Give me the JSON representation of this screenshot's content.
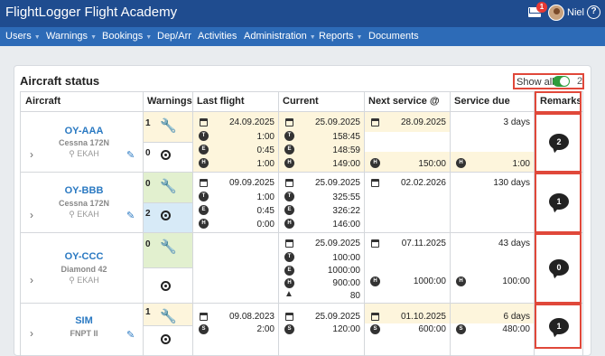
{
  "header": {
    "brand": "FlightLogger Flight Academy",
    "mail_badge": "1",
    "username": "Niel",
    "help_glyph": "?"
  },
  "nav": [
    {
      "label": "Users",
      "dropdown": true
    },
    {
      "label": "Warnings",
      "dropdown": true
    },
    {
      "label": "Bookings",
      "dropdown": true
    },
    {
      "label": "Dep/Arr",
      "dropdown": false
    },
    {
      "label": "Activities",
      "dropdown": false
    },
    {
      "label": "Administration",
      "dropdown": true
    },
    {
      "label": "Reports",
      "dropdown": true
    },
    {
      "label": "Documents",
      "dropdown": false
    }
  ],
  "panel": {
    "title": "Aircraft status",
    "show_all_label": "Show all",
    "show_all_on": true,
    "show_all_count": "2"
  },
  "columns": [
    "Aircraft",
    "Warnings",
    "Last flight",
    "Current",
    "Next service @",
    "Service due",
    "Remarks"
  ],
  "rows": [
    {
      "registration": "OY-AAA",
      "model": "Cessna 172N",
      "location": "EKAH",
      "warnings": {
        "maintenance": "1",
        "tyre": "0"
      },
      "last_flight": [
        "24.09.2025",
        "1:00",
        "0:45",
        "1:00"
      ],
      "current": [
        "25.09.2025",
        "158:45",
        "148:59",
        "149:00"
      ],
      "next_service": [
        "28.09.2025",
        "150:00"
      ],
      "service_due": [
        "3 days",
        "1:00"
      ],
      "remarks": "2"
    },
    {
      "registration": "OY-BBB",
      "model": "Cessna 172N",
      "location": "EKAH",
      "warnings": {
        "maintenance": "0",
        "tyre": "2"
      },
      "last_flight": [
        "09.09.2025",
        "1:00",
        "0:45",
        "0:00"
      ],
      "current": [
        "25.09.2025",
        "325:55",
        "326:22",
        "146:00"
      ],
      "next_service": [
        "02.02.2026"
      ],
      "service_due": [
        "130 days"
      ],
      "remarks": "1"
    },
    {
      "registration": "OY-CCC",
      "model": "Diamond 42",
      "location": "EKAH",
      "warnings": {
        "maintenance": "0",
        "tyre": ""
      },
      "last_flight": [],
      "current": [
        "25.09.2025",
        "100:00",
        "1000:00",
        "900:00",
        "80"
      ],
      "next_service": [
        "07.11.2025",
        "1000:00"
      ],
      "service_due": [
        "43 days",
        "100:00"
      ],
      "remarks": "0"
    },
    {
      "registration": "SIM",
      "model": "FNPT II",
      "location": "",
      "warnings": {
        "maintenance": "1",
        "tyre": ""
      },
      "last_flight": [
        "09.08.2023",
        "2:00"
      ],
      "current": [
        "25.09.2025",
        "120:00"
      ],
      "next_service": [
        "01.10.2025",
        "600:00"
      ],
      "service_due": [
        "6 days",
        "480:00"
      ],
      "remarks": "1"
    }
  ],
  "icons": [
    "mail-icon",
    "help-icon",
    "calendar-icon",
    "clock-icon",
    "wrench-icon",
    "tyre-icon",
    "landing-icon",
    "pencil-icon",
    "chevron-right-icon",
    "comment-icon",
    "location-pin-icon"
  ],
  "colors": {
    "header": "#1f4c8f",
    "nav": "#2d6bb7",
    "link": "#2a79c2",
    "warning_yellow": "#fdf5dc",
    "ok_green": "#e2f0cf",
    "info_blue": "#d7eaf7",
    "highlight_red": "#e0483a",
    "toggle_on": "#2e9c3d"
  }
}
